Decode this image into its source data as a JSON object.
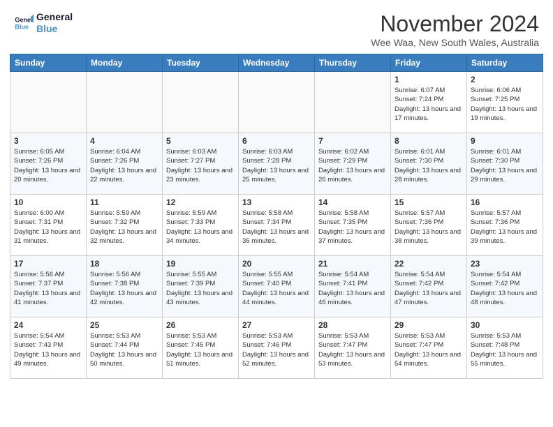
{
  "header": {
    "logo_line1": "General",
    "logo_line2": "Blue",
    "title": "November 2024",
    "subtitle": "Wee Waa, New South Wales, Australia"
  },
  "weekdays": [
    "Sunday",
    "Monday",
    "Tuesday",
    "Wednesday",
    "Thursday",
    "Friday",
    "Saturday"
  ],
  "weeks": [
    [
      {
        "day": "",
        "info": ""
      },
      {
        "day": "",
        "info": ""
      },
      {
        "day": "",
        "info": ""
      },
      {
        "day": "",
        "info": ""
      },
      {
        "day": "",
        "info": ""
      },
      {
        "day": "1",
        "info": "Sunrise: 6:07 AM\nSunset: 7:24 PM\nDaylight: 13 hours and 17 minutes."
      },
      {
        "day": "2",
        "info": "Sunrise: 6:06 AM\nSunset: 7:25 PM\nDaylight: 13 hours and 19 minutes."
      }
    ],
    [
      {
        "day": "3",
        "info": "Sunrise: 6:05 AM\nSunset: 7:26 PM\nDaylight: 13 hours and 20 minutes."
      },
      {
        "day": "4",
        "info": "Sunrise: 6:04 AM\nSunset: 7:26 PM\nDaylight: 13 hours and 22 minutes."
      },
      {
        "day": "5",
        "info": "Sunrise: 6:03 AM\nSunset: 7:27 PM\nDaylight: 13 hours and 23 minutes."
      },
      {
        "day": "6",
        "info": "Sunrise: 6:03 AM\nSunset: 7:28 PM\nDaylight: 13 hours and 25 minutes."
      },
      {
        "day": "7",
        "info": "Sunrise: 6:02 AM\nSunset: 7:29 PM\nDaylight: 13 hours and 26 minutes."
      },
      {
        "day": "8",
        "info": "Sunrise: 6:01 AM\nSunset: 7:30 PM\nDaylight: 13 hours and 28 minutes."
      },
      {
        "day": "9",
        "info": "Sunrise: 6:01 AM\nSunset: 7:30 PM\nDaylight: 13 hours and 29 minutes."
      }
    ],
    [
      {
        "day": "10",
        "info": "Sunrise: 6:00 AM\nSunset: 7:31 PM\nDaylight: 13 hours and 31 minutes."
      },
      {
        "day": "11",
        "info": "Sunrise: 5:59 AM\nSunset: 7:32 PM\nDaylight: 13 hours and 32 minutes."
      },
      {
        "day": "12",
        "info": "Sunrise: 5:59 AM\nSunset: 7:33 PM\nDaylight: 13 hours and 34 minutes."
      },
      {
        "day": "13",
        "info": "Sunrise: 5:58 AM\nSunset: 7:34 PM\nDaylight: 13 hours and 35 minutes."
      },
      {
        "day": "14",
        "info": "Sunrise: 5:58 AM\nSunset: 7:35 PM\nDaylight: 13 hours and 37 minutes."
      },
      {
        "day": "15",
        "info": "Sunrise: 5:57 AM\nSunset: 7:36 PM\nDaylight: 13 hours and 38 minutes."
      },
      {
        "day": "16",
        "info": "Sunrise: 5:57 AM\nSunset: 7:36 PM\nDaylight: 13 hours and 39 minutes."
      }
    ],
    [
      {
        "day": "17",
        "info": "Sunrise: 5:56 AM\nSunset: 7:37 PM\nDaylight: 13 hours and 41 minutes."
      },
      {
        "day": "18",
        "info": "Sunrise: 5:56 AM\nSunset: 7:38 PM\nDaylight: 13 hours and 42 minutes."
      },
      {
        "day": "19",
        "info": "Sunrise: 5:55 AM\nSunset: 7:39 PM\nDaylight: 13 hours and 43 minutes."
      },
      {
        "day": "20",
        "info": "Sunrise: 5:55 AM\nSunset: 7:40 PM\nDaylight: 13 hours and 44 minutes."
      },
      {
        "day": "21",
        "info": "Sunrise: 5:54 AM\nSunset: 7:41 PM\nDaylight: 13 hours and 46 minutes."
      },
      {
        "day": "22",
        "info": "Sunrise: 5:54 AM\nSunset: 7:42 PM\nDaylight: 13 hours and 47 minutes."
      },
      {
        "day": "23",
        "info": "Sunrise: 5:54 AM\nSunset: 7:42 PM\nDaylight: 13 hours and 48 minutes."
      }
    ],
    [
      {
        "day": "24",
        "info": "Sunrise: 5:54 AM\nSunset: 7:43 PM\nDaylight: 13 hours and 49 minutes."
      },
      {
        "day": "25",
        "info": "Sunrise: 5:53 AM\nSunset: 7:44 PM\nDaylight: 13 hours and 50 minutes."
      },
      {
        "day": "26",
        "info": "Sunrise: 5:53 AM\nSunset: 7:45 PM\nDaylight: 13 hours and 51 minutes."
      },
      {
        "day": "27",
        "info": "Sunrise: 5:53 AM\nSunset: 7:46 PM\nDaylight: 13 hours and 52 minutes."
      },
      {
        "day": "28",
        "info": "Sunrise: 5:53 AM\nSunset: 7:47 PM\nDaylight: 13 hours and 53 minutes."
      },
      {
        "day": "29",
        "info": "Sunrise: 5:53 AM\nSunset: 7:47 PM\nDaylight: 13 hours and 54 minutes."
      },
      {
        "day": "30",
        "info": "Sunrise: 5:53 AM\nSunset: 7:48 PM\nDaylight: 13 hours and 55 minutes."
      }
    ]
  ]
}
